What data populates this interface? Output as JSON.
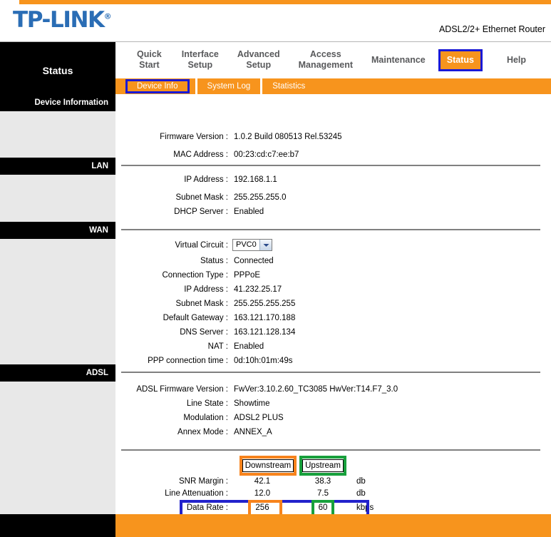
{
  "header": {
    "logo_text": "TP-LINK",
    "logo_reg": "®",
    "model": "ADSL2/2+ Ethernet Router",
    "page_title": "Status"
  },
  "nav": {
    "items": [
      {
        "label_line1": "Quick",
        "label_line2": "Start",
        "selected": false
      },
      {
        "label_line1": "Interface",
        "label_line2": "Setup",
        "selected": false
      },
      {
        "label_line1": "Advanced",
        "label_line2": "Setup",
        "selected": false
      },
      {
        "label_line1": "Access",
        "label_line2": "Management",
        "selected": false
      },
      {
        "label_line1": "Maintenance",
        "label_line2": "",
        "selected": false
      },
      {
        "label_line1": "Status",
        "label_line2": "",
        "selected": true
      },
      {
        "label_line1": "Help",
        "label_line2": "",
        "selected": false
      }
    ]
  },
  "subnav": {
    "items": [
      {
        "label": "Device Info",
        "selected": true
      },
      {
        "label": "System Log",
        "selected": false
      },
      {
        "label": "Statistics",
        "selected": false
      }
    ]
  },
  "sections": {
    "device_information": {
      "title": "Device Information",
      "rows": [
        {
          "label": "Firmware Version :",
          "value": "1.0.2 Build 080513 Rel.53245"
        },
        {
          "label": "MAC Address :",
          "value": "00:23:cd:c7:ee:b7"
        }
      ]
    },
    "lan": {
      "title": "LAN",
      "rows": [
        {
          "label": "IP Address :",
          "value": "192.168.1.1"
        },
        {
          "label": "Subnet Mask :",
          "value": "255.255.255.0"
        },
        {
          "label": "DHCP Server :",
          "value": "Enabled"
        }
      ]
    },
    "wan": {
      "title": "WAN",
      "virtual_circuit_label": "Virtual Circuit :",
      "virtual_circuit_value": "PVC0",
      "rows": [
        {
          "label": "Status :",
          "value": "Connected"
        },
        {
          "label": "Connection Type :",
          "value": "PPPoE"
        },
        {
          "label": "IP Address :",
          "value": "41.232.25.17"
        },
        {
          "label": "Subnet Mask :",
          "value": "255.255.255.255"
        },
        {
          "label": "Default Gateway :",
          "value": "163.121.170.188"
        },
        {
          "label": "DNS Server :",
          "value": "163.121.128.134"
        },
        {
          "label": "NAT :",
          "value": "Enabled"
        },
        {
          "label": "PPP connection time :",
          "value": "0d:10h:01m:49s"
        }
      ]
    },
    "adsl": {
      "title": "ADSL",
      "rows": [
        {
          "label": "ADSL Firmware Version :",
          "value": "FwVer:3.10.2.60_TC3085 HwVer:T14.F7_3.0"
        },
        {
          "label": "Line State :",
          "value": "Showtime"
        },
        {
          "label": "Modulation :",
          "value": "ADSL2 PLUS"
        },
        {
          "label": "Annex Mode :",
          "value": "ANNEX_A"
        }
      ],
      "stats": {
        "col_downstream": "Downstream",
        "col_upstream": "Upstream",
        "rows": [
          {
            "label": "SNR Margin :",
            "downstream": "42.1",
            "upstream": "38.3",
            "unit": "db"
          },
          {
            "label": "Line Attenuation :",
            "downstream": "12.0",
            "upstream": "7.5",
            "unit": "db"
          },
          {
            "label": "Data Rate :",
            "downstream": "256",
            "upstream": "60",
            "unit": "kbps"
          }
        ]
      }
    }
  },
  "annotations": {
    "orange_color": "#F7831C",
    "green_color": "#18A03C",
    "blue_color": "#2222CC"
  },
  "theme": {
    "orange": "#F7941D",
    "logo_blue": "#2A6DB5",
    "black": "#000000"
  }
}
